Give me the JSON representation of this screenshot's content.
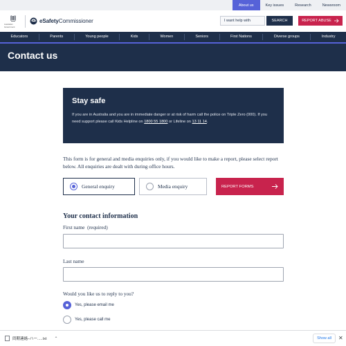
{
  "utility_nav": [
    "About us",
    "Key issues",
    "Research",
    "Newsroom"
  ],
  "header": {
    "gov_logo_text": "Australian Government",
    "brand_bold": "eSafety",
    "brand_rest": "Commissioner",
    "help_placeholder": "I want help with",
    "search_label": "SEARCH",
    "report_label": "REPORT ABUSE"
  },
  "main_nav": [
    "Educators",
    "Parents",
    "Young people",
    "Kids",
    "Women",
    "Seniors",
    "First Nations",
    "Diverse groups",
    "Industry"
  ],
  "page_title": "Contact us",
  "stay_safe": {
    "title": "Stay safe",
    "text_1": "If you are in Australia and you are in immediate danger or at risk of harm call the police on Triple Zero (000). If you need support please call Kids Helpline on ",
    "kids_helpline": "1800 55 1800",
    "text_2": " or Lifeline on ",
    "lifeline": "13 11 14",
    "text_3": "."
  },
  "intro": "This form is for general and media enquiries only, if you would like to make a report, please select report below. All enquiries are dealt with during office hours.",
  "enquiry_options": {
    "general": "General enquiry",
    "media": "Media enquiry",
    "report_forms": "REPORT FORMS"
  },
  "contact_section": {
    "title": "Your contact information",
    "first_name_label": "First name",
    "required_tag": "(required)",
    "last_name_label": "Last name",
    "reply_question": "Would you like us to reply to you?",
    "reply_email": "Yes, please email me",
    "reply_call": "Yes, please call me"
  },
  "download_bar": {
    "filename": "同期連絡–ハー.....txt",
    "show_all": "Show all"
  },
  "colors": {
    "navy": "#1e2f4a",
    "accent": "#5662d8",
    "report_red": "#c8234d"
  }
}
